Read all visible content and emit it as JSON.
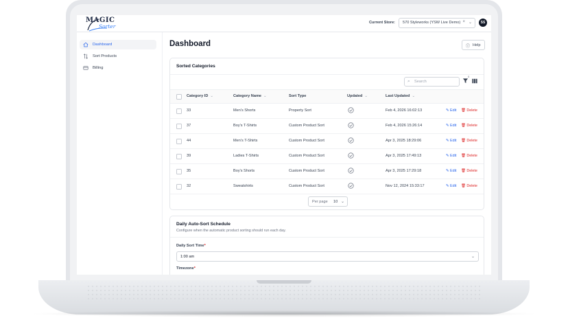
{
  "header": {
    "logo_top": "MAGIC",
    "logo_bottom": "Sorter",
    "store_label": "Current Store:",
    "store_value": "570 Styleworks (YSW Live Demo)",
    "clear_glyph": "×",
    "chevron_glyph": "⌄",
    "avatar": "SS"
  },
  "sidebar": {
    "items": [
      {
        "label": "Dashboard",
        "icon": "home-icon",
        "active": true
      },
      {
        "label": "Sort Products",
        "icon": "sort-icon",
        "active": false
      },
      {
        "label": "Billing",
        "icon": "billing-icon",
        "active": false
      }
    ]
  },
  "main": {
    "title": "Dashboard",
    "help_label": "Help",
    "help_glyph": "ⓘ"
  },
  "sorted_categories": {
    "title": "Sorted Categories",
    "search_placeholder": "Search",
    "search_glyph": "⌕",
    "filter_count": "0",
    "columns": {
      "category_id": "Category ID",
      "category_name": "Category Name",
      "sort_type": "Sort Type",
      "updated": "Updated",
      "last_updated": "Last Updated",
      "sort_glyph": "⌄"
    },
    "rows": [
      {
        "id": "33",
        "name": "Men's Shorts",
        "sort_type": "Property Sort",
        "last_updated": "Feb 4, 2026 16:02:13"
      },
      {
        "id": "37",
        "name": "Boy's T-Shirts",
        "sort_type": "Custom Product Sort",
        "last_updated": "Feb 4, 2026 15:26:14"
      },
      {
        "id": "44",
        "name": "Men's T-Shirts",
        "sort_type": "Custom Product Sort",
        "last_updated": "Apr 3, 2025 18:29:06"
      },
      {
        "id": "39",
        "name": "Ladies T-Shirts",
        "sort_type": "Custom Product Sort",
        "last_updated": "Apr 3, 2025 17:49:13"
      },
      {
        "id": "35",
        "name": "Boy's Shorts",
        "sort_type": "Custom Product Sort",
        "last_updated": "Apr 3, 2025 17:29:18"
      },
      {
        "id": "32",
        "name": "Sweatshirts",
        "sort_type": "Custom Product Sort",
        "last_updated": "Nov 12, 2024 15:33:17"
      }
    ],
    "edit_label": "Edit",
    "delete_label": "Delete",
    "per_page_label": "Per page",
    "per_page_value": "10",
    "chevron_glyph": "⌄"
  },
  "schedule": {
    "title": "Daily Auto-Sort Schedule",
    "subtitle": "Configure when the automatic product sorting should run each day.",
    "time_label": "Daily Sort Time",
    "time_value": "1:00 am",
    "timezone_label": "Timezone",
    "required_mark": "*",
    "chevron_glyph": "⌄"
  },
  "colors": {
    "accent": "#2563eb",
    "danger": "#dc2626",
    "brand_dark": "#1f2a44"
  }
}
